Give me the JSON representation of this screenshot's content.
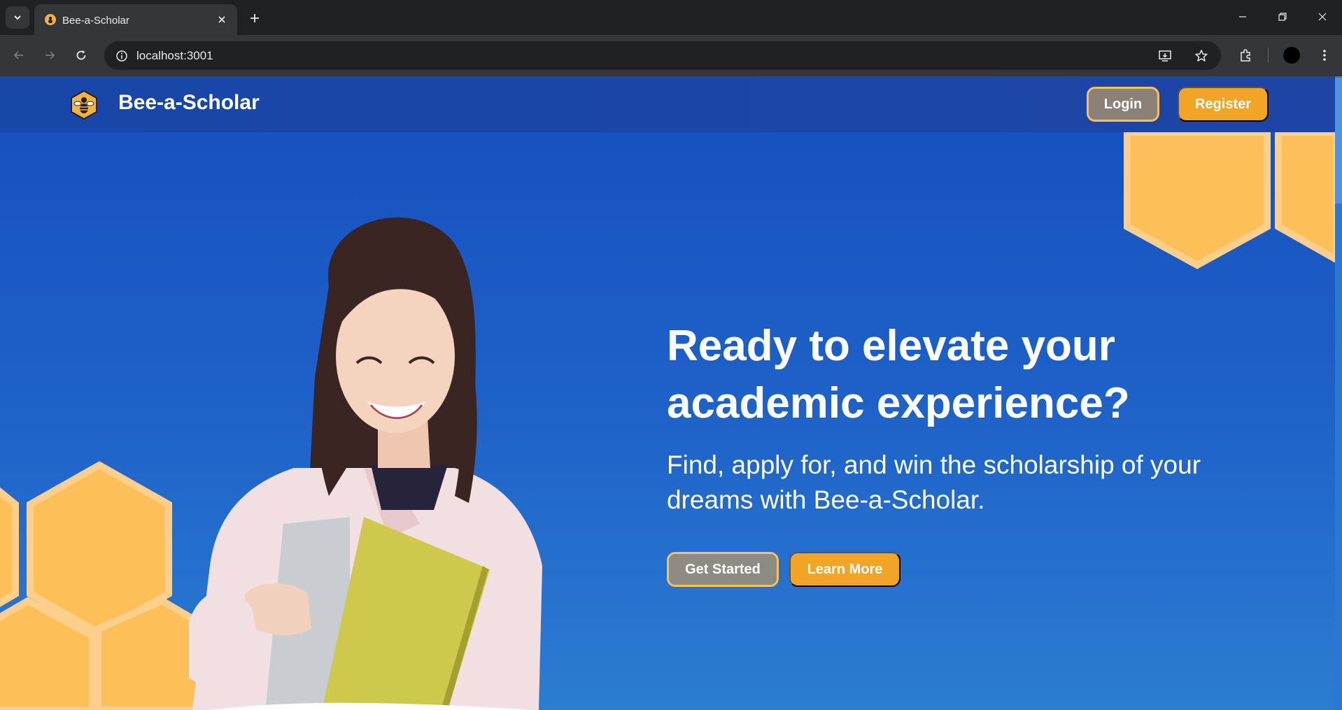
{
  "browser": {
    "tab_title": "Bee-a-Scholar",
    "url": "localhost:3001"
  },
  "site": {
    "brand": "Bee-a-Scholar",
    "login_label": "Login",
    "register_label": "Register"
  },
  "hero": {
    "title_line1": "Ready to elevate your",
    "title_line2": "academic experience?",
    "subtitle_line1": "Find, apply for, and win the scholarship of your",
    "subtitle_line2": "dreams with Bee-a-Scholar.",
    "get_started_label": "Get Started",
    "learn_more_label": "Learn More"
  },
  "colors": {
    "accent": "#f1a426",
    "honeycomb": "#fdbf58",
    "header_bg": "#1e45a6"
  }
}
